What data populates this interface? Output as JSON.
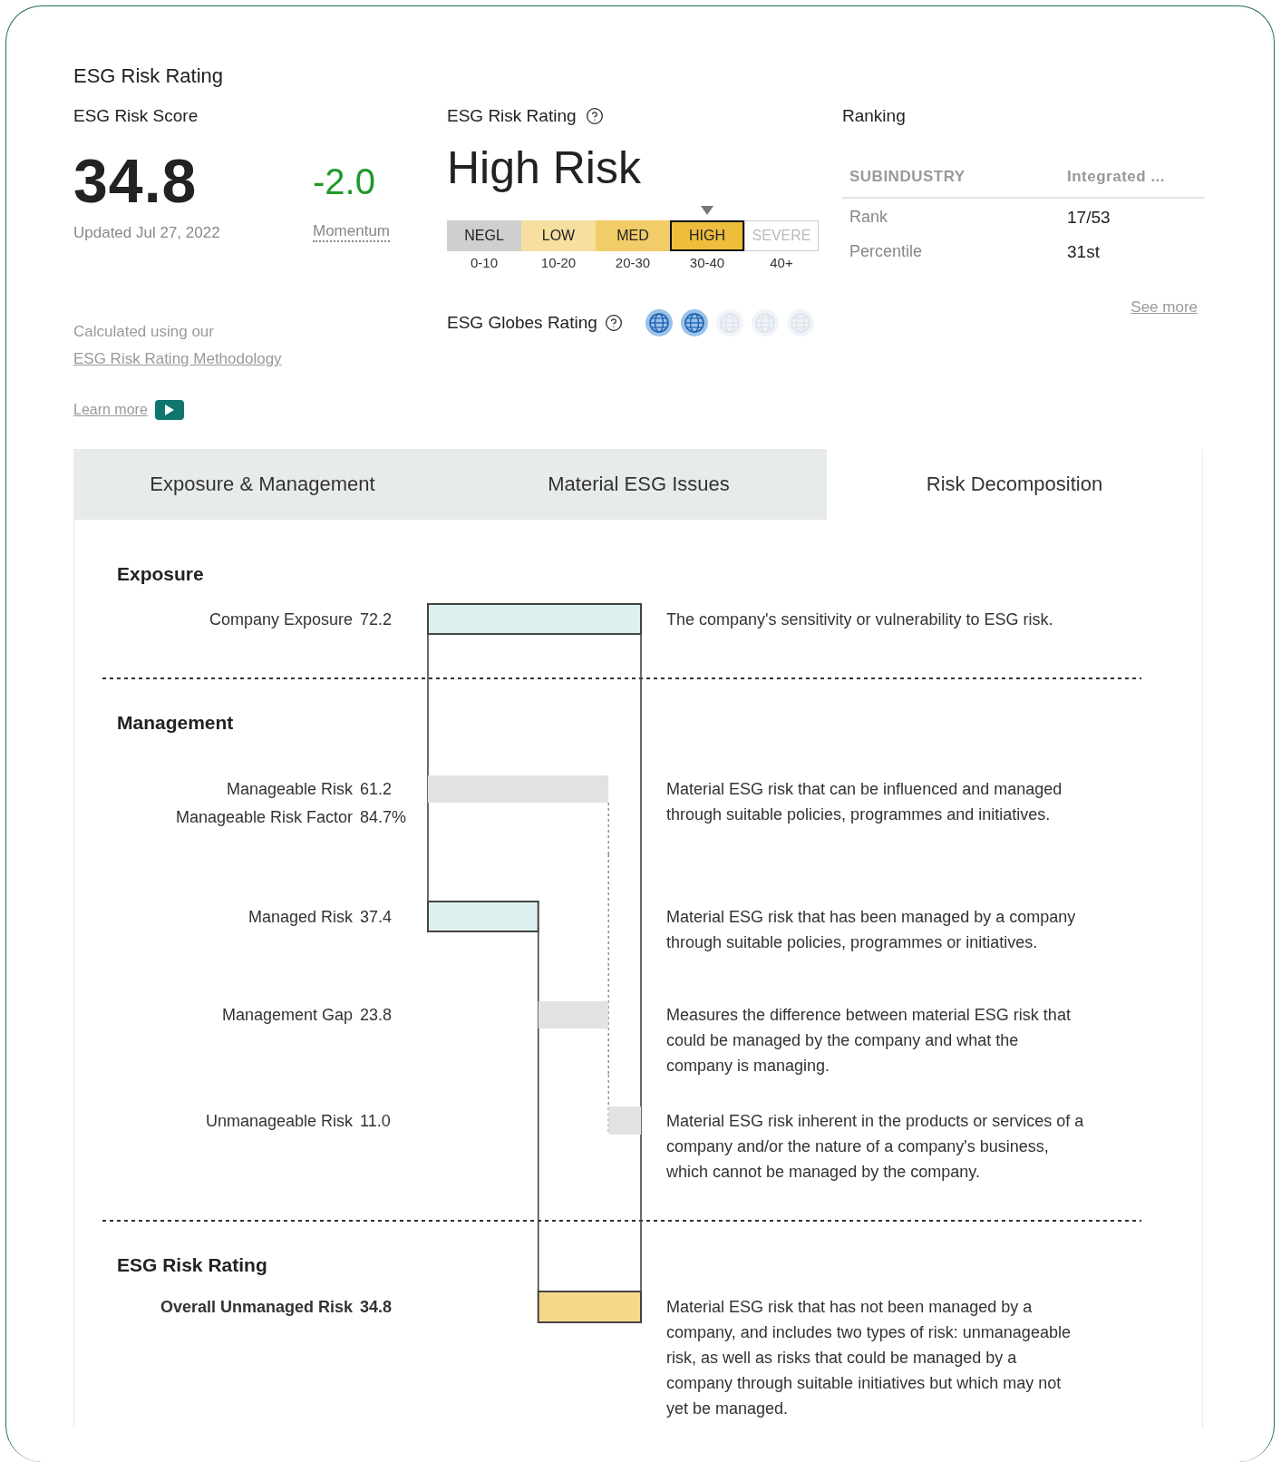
{
  "title": "ESG Risk Rating",
  "score": {
    "heading": "ESG Risk Score",
    "value": "34.8",
    "updated": "Updated Jul 27, 2022",
    "momentum_value": "-2.0",
    "momentum_label": "Momentum",
    "note": "Calculated using our",
    "note_link": "ESG Risk Rating Methodology",
    "learn_more": "Learn more"
  },
  "rating": {
    "heading": "ESG Risk Rating",
    "value": "High Risk",
    "segments": [
      {
        "label": "NEGL",
        "range": "0-10",
        "color": "#cfcfcf",
        "selected": false,
        "muted": false
      },
      {
        "label": "LOW",
        "range": "10-20",
        "color": "#f6dfa0",
        "selected": false,
        "muted": false
      },
      {
        "label": "MED",
        "range": "20-30",
        "color": "#f1cc68",
        "selected": false,
        "muted": false
      },
      {
        "label": "HIGH",
        "range": "30-40",
        "color": "#efbd3c",
        "selected": true,
        "muted": false
      },
      {
        "label": "SEVERE",
        "range": "40+",
        "color": "#ffffff",
        "selected": false,
        "muted": true
      }
    ],
    "globes": {
      "label": "ESG Globes Rating",
      "stars": 2
    }
  },
  "ranking": {
    "heading": "Ranking",
    "columns": [
      "SUBINDUSTRY",
      "Integrated ..."
    ],
    "rows": [
      {
        "label": "Rank",
        "value": "17/53"
      },
      {
        "label": "Percentile",
        "value": "31st"
      }
    ],
    "see_more": "See more"
  },
  "tabs": [
    {
      "label": "Exposure & Management",
      "selected": false
    },
    {
      "label": "Material ESG Issues",
      "selected": false
    },
    {
      "label": "Risk Decomposition",
      "selected": true
    }
  ],
  "decomposition": [
    {
      "kind": "heading",
      "label": "Exposure"
    },
    {
      "kind": "exposure",
      "label": "Company Exposure",
      "value": "72.2",
      "description": "The company's sensitivity or vulnerability to ESG risk."
    },
    {
      "kind": "divider"
    },
    {
      "kind": "heading",
      "label": "Management"
    },
    {
      "kind": "manageable",
      "label": "Manageable Risk",
      "value": "61.2",
      "factor_label": "Manageable Risk Factor",
      "factor_value": "84.7%",
      "description": "Material ESG risk that can be influenced and managed through suitable policies, programmes and initiatives."
    },
    {
      "kind": "managed",
      "label": "Managed Risk",
      "value": "37.4",
      "description": "Material ESG risk that has been managed by a company through suitable policies, programmes or initiatives."
    },
    {
      "kind": "gap",
      "label": "Management Gap",
      "value": "23.8",
      "description": "Measures the difference between material ESG risk that could be managed by the company and what the company is managing."
    },
    {
      "kind": "unmanageable",
      "label": "Unmanageable Risk",
      "value": "11.0",
      "description": "Material ESG risk inherent in the products or services of a company and/or the nature of a company's business, which cannot be managed by the company."
    },
    {
      "kind": "divider"
    },
    {
      "kind": "heading",
      "label": "ESG Risk Rating"
    },
    {
      "kind": "overall",
      "label": "Overall Unmanaged Risk",
      "value": "34.8",
      "description": "Material ESG risk that has not been managed by a company, and includes two types of risk: unmanageable risk, as well as risks that could be managed by a company through suitable initiatives but which may not yet be managed."
    }
  ]
}
